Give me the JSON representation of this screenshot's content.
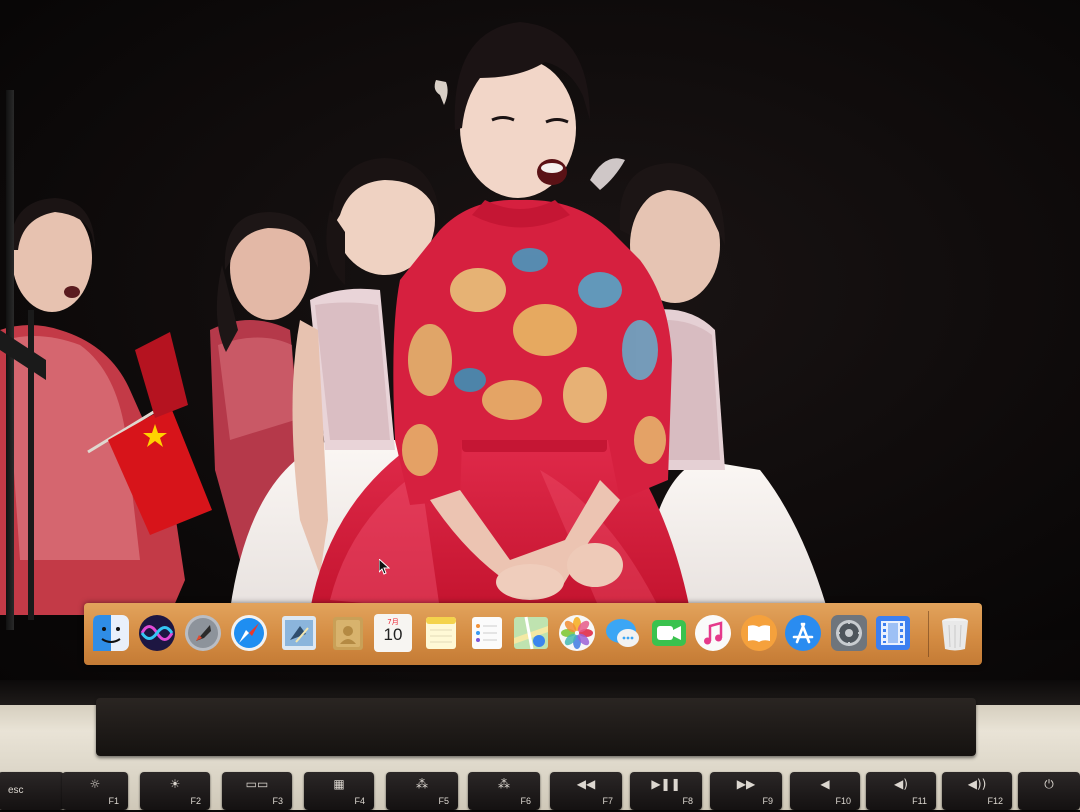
{
  "dock": {
    "items": [
      {
        "name": "finder-icon",
        "label": "Finder"
      },
      {
        "name": "siri-icon",
        "label": "Siri"
      },
      {
        "name": "launchpad-icon",
        "label": "Launchpad"
      },
      {
        "name": "safari-icon",
        "label": "Safari"
      },
      {
        "name": "mail-icon",
        "label": "Mail"
      },
      {
        "name": "contacts-icon",
        "label": "Contacts"
      },
      {
        "name": "calendar-icon",
        "label": "Calendar"
      },
      {
        "name": "notes-icon",
        "label": "Notes"
      },
      {
        "name": "reminders-icon",
        "label": "Reminders"
      },
      {
        "name": "maps-icon",
        "label": "Maps"
      },
      {
        "name": "photos-icon",
        "label": "Photos"
      },
      {
        "name": "messages-icon",
        "label": "Messages"
      },
      {
        "name": "facetime-icon",
        "label": "FaceTime"
      },
      {
        "name": "music-icon",
        "label": "iTunes"
      },
      {
        "name": "books-icon",
        "label": "iBooks"
      },
      {
        "name": "app-store-icon",
        "label": "App Store"
      },
      {
        "name": "system-preferences-icon",
        "label": "System Preferences"
      },
      {
        "name": "quicktime-icon",
        "label": "QuickTime Player"
      },
      {
        "name": "trash-icon",
        "label": "Trash"
      }
    ],
    "calendar": {
      "month": "7月",
      "day": "10"
    }
  },
  "keyboard": {
    "keys": [
      {
        "name": "key-esc",
        "label": "esc",
        "icon": ""
      },
      {
        "name": "key-f1",
        "label": "F1",
        "icon": "☼"
      },
      {
        "name": "key-f2",
        "label": "F2",
        "icon": "☀"
      },
      {
        "name": "key-f3",
        "label": "F3",
        "icon": "▭▭"
      },
      {
        "name": "key-f4",
        "label": "F4",
        "icon": "▦"
      },
      {
        "name": "key-f5",
        "label": "F5",
        "icon": "⁂"
      },
      {
        "name": "key-f6",
        "label": "F6",
        "icon": "⁂"
      },
      {
        "name": "key-f7",
        "label": "F7",
        "icon": "◀◀"
      },
      {
        "name": "key-f8",
        "label": "F8",
        "icon": "▶❚❚"
      },
      {
        "name": "key-f9",
        "label": "F9",
        "icon": "▶▶"
      },
      {
        "name": "key-f10",
        "label": "F10",
        "icon": "◀"
      },
      {
        "name": "key-f11",
        "label": "F11",
        "icon": "◀)"
      },
      {
        "name": "key-f12",
        "label": "F12",
        "icon": "◀))"
      },
      {
        "name": "key-power",
        "label": "",
        "icon": "⏻"
      }
    ]
  },
  "colors": {
    "dock_orange": "#d48c43",
    "dress_red": "#d21f3c",
    "flag_red": "#d7141a",
    "flag_star": "#ffd200"
  }
}
